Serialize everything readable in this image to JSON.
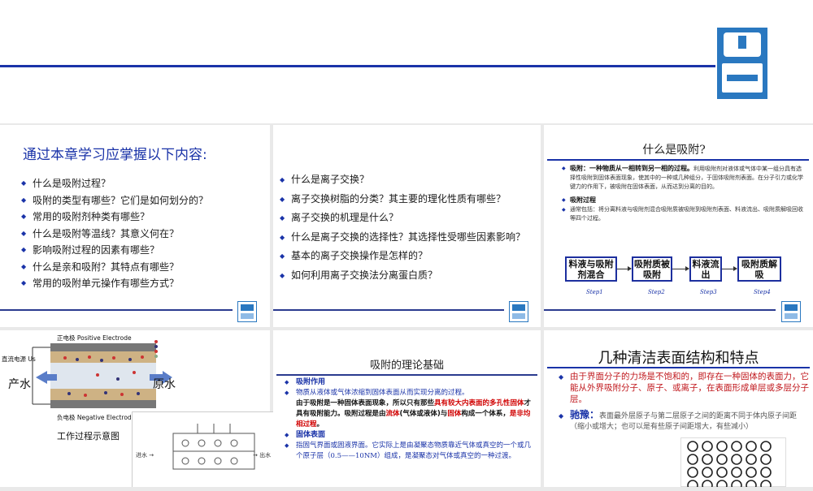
{
  "slide1": {
    "title": "通过本章学习应掌握以下内容:",
    "items": [
      "什么是吸附过程？",
      "吸附的类型有哪些？它们是如何划分的？",
      "常用的吸附剂种类有哪些？",
      "什么是吸附等温线？其意义何在？",
      "影响吸附过程的因素有哪些？",
      "什么是亲和吸附？其特点有哪些？",
      "常用的吸附单元操作有哪些方式？"
    ]
  },
  "slide2": {
    "items": [
      "什么是离子交换？",
      "离子交换树脂的分类？其主要的理化性质有哪些？",
      "离子交换的机理是什么？",
      "什么是离子交换的选择性？其选择性受哪些因素影响？",
      "基本的离子交换操作是怎样的？",
      "如何利用离子交换法分离蛋白质？"
    ]
  },
  "slide3": {
    "title": "什么是吸附?",
    "def_head": "吸附：一种物质从一相转到另一相的过程。",
    "def_tail": "利用吸附剂对液体或气体中某一组分具有选择性吸附到固体表面现象，使其中的一种或几种组分，于固体吸附剂表面。在分子引力或化学键力的作用下，被吸附在固体表面，从而达到分离的目的。",
    "proc_head": "吸附过程",
    "proc_body": "通常包括：将分离料液与吸附剂混合吸附质被吸附到吸附剂表面、料液流出、吸附质解吸回收等四个过程。",
    "steps": [
      {
        "box": "料液与吸附剂混合",
        "label": "Step1"
      },
      {
        "box": "吸附质被吸附",
        "label": "Step2"
      },
      {
        "box": "料液流出",
        "label": "Step3"
      },
      {
        "box": "吸附质解吸",
        "label": "Step4"
      }
    ]
  },
  "slide4": {
    "pos_label": "正电极 Positive Electrode",
    "neg_label": "负电极 Negative Electrode",
    "source_label": "直流电源 Us",
    "out_label": "产水",
    "in_label": "原水",
    "caption": "工作过程示意图",
    "overlay_in": "进水 →",
    "overlay_out": "→ 出水"
  },
  "slide5": {
    "title": "吸附的理论基础",
    "b1_head": "吸附作用",
    "b1_text": "物质从液体或气体浓缩到固体表面从而实现分离的过程。",
    "b1_bold1": "由于吸附是一种固体表面现象，所以只有那些",
    "b1_red1": "具有较大内表面的多孔性固体",
    "b1_bold2": "才具有吸附能力。吸附过程是由",
    "b1_red2": "流体",
    "b1_bold3": "(气体或液体)与",
    "b1_red3": "固体",
    "b1_bold4": "构成一个体系，",
    "b1_blue": "是非均相过程",
    "b1_end": "。",
    "b2_head": "固体表面",
    "b2_text": "指固气界面或固液界面。它实际上是由凝聚态物质靠近气体或真空的一个或几个原子层（0.5——10NM）组成，是凝聚态对气体或真空的一种过渡。"
  },
  "slide6": {
    "title": "几种清洁表面结构和特点",
    "p1": "由于界面分子的力场是不饱和的，即存在一种固体的表面力，它能从外界吸附分子、原子、或离子，在表面形成单层或多层分子层。",
    "p2_term": "驰豫：",
    "p2_text": "表面最外层原子与第二层原子之间的距离不同于体内原子间距（缩小或增大；也可以是有些原子间距增大，有些减小）"
  },
  "colors": {
    "accent": "#1a33a8",
    "emphasis_red": "#d00000",
    "logo_blue": "#2a78c0"
  }
}
